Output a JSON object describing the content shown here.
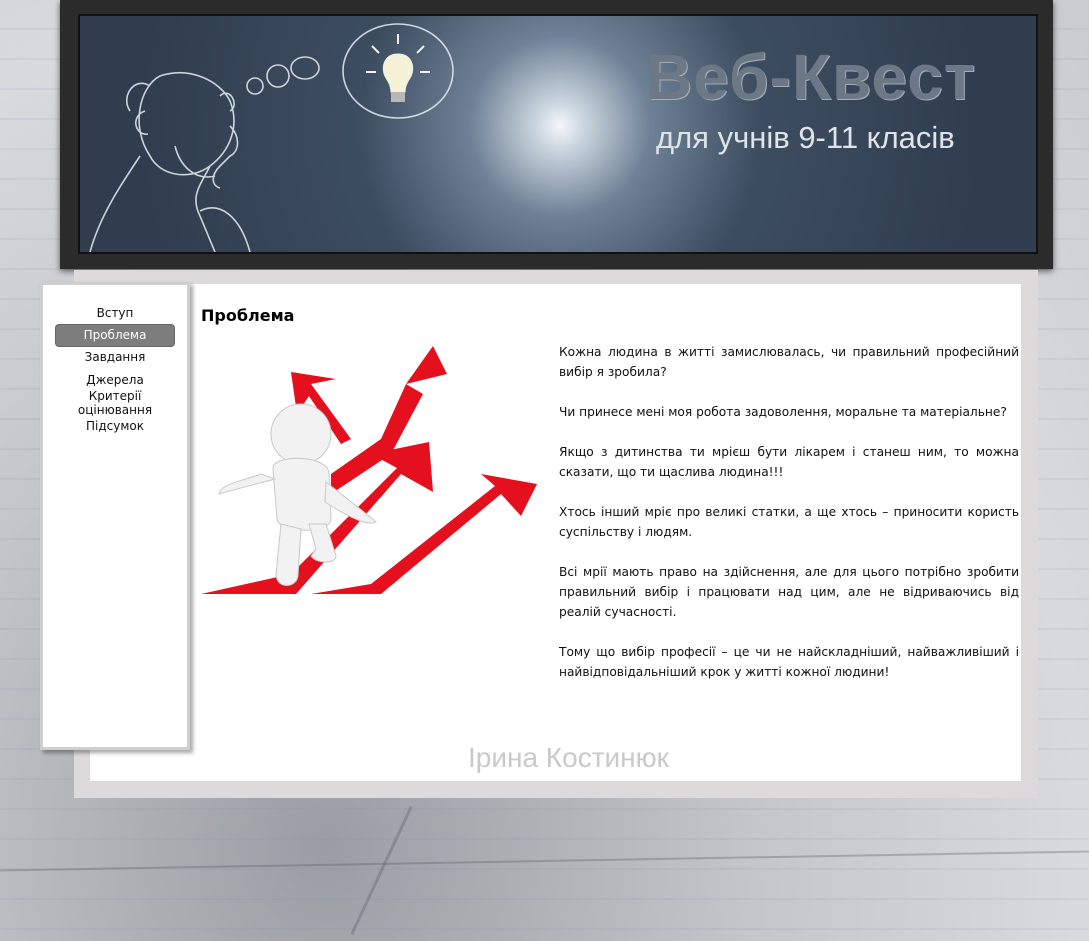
{
  "header": {
    "title": "Веб-Квест",
    "subtitle": "для учнів 9-11 класів",
    "icon": "lightbulb-icon"
  },
  "sidebar": {
    "items": [
      {
        "label": "Вступ",
        "active": false
      },
      {
        "label": "Проблема",
        "active": true
      },
      {
        "label": "Завдання",
        "active": false
      },
      {
        "label": "Джерела",
        "active": false
      },
      {
        "label": "Критерії оцінювання",
        "active": false
      },
      {
        "label": "Підсумок",
        "active": false
      }
    ]
  },
  "main": {
    "title": "Проблема",
    "paragraphs": [
      "Кожна людина в житті замислювалась, чи правильний професійний вибір я зробила?",
      "Чи принесе мені моя робота задоволення, моральне та матеріальне?",
      "Якщо з дитинства ти мрієш бути лікарем і станеш ним, то можна сказати, що ти щаслива людина!!!",
      "Хтось інший мріє про великі статки, а ще хтось – приносити користь суспільству і людям.",
      "Всі мрії мають право на здійснення, але для цього потрібно зробити правильний вибір і працювати над цим, але не відриваючись від реалій сучасності.",
      "Тому що вибір професії – це чи не найскладніший, найважливіший і найвідповідальніший крок у житті кожної людини!"
    ]
  },
  "footer": {
    "signature": "Ірина Костинюк"
  },
  "colors": {
    "arrow_red": "#e4101e",
    "nav_active_bg": "#7d7d7d",
    "banner_dark": "#2f3d4e"
  }
}
